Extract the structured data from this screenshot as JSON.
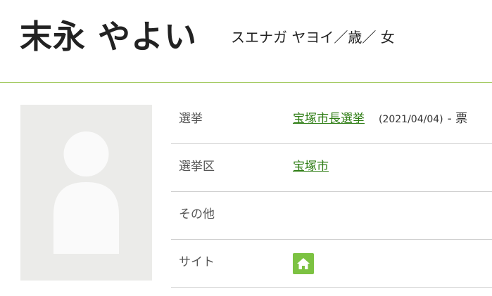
{
  "profile": {
    "name": "末永 やよい",
    "kana": "スエナガ ヤヨイ／歳／ 女"
  },
  "details": {
    "election": {
      "label": "選挙",
      "link_text": "宝塚市長選挙",
      "date": "(2021/04/04)",
      "separator": "- 票"
    },
    "district": {
      "label": "選挙区",
      "link_text": "宝塚市"
    },
    "other": {
      "label": "その他"
    },
    "site": {
      "label": "サイト",
      "icon": "home-icon",
      "icon_color": "#7cc242"
    }
  },
  "colors": {
    "accent_line": "#9fc85a",
    "link": "#2e7d14",
    "photo_bg": "#ebebe9"
  }
}
